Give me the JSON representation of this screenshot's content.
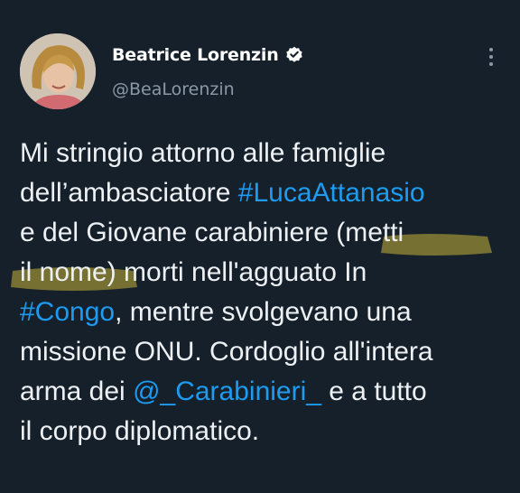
{
  "tweet": {
    "author": {
      "display_name": "Beatrice Lorenzin",
      "handle": "@BeaLorenzin",
      "verified": true
    },
    "icons": {
      "verified": "verified-badge-icon",
      "more": "more-options-icon"
    },
    "text_lines": [
      [
        {
          "t": "Mi stringio attorno alle famiglie"
        }
      ],
      [
        {
          "t": "dell’ambasciatore "
        },
        {
          "t": "#LucaAttanasio",
          "link": true
        }
      ],
      [
        {
          "t": "e del Giovane carabiniere (metti"
        }
      ],
      [
        {
          "t": "il nome) morti nell'agguato In"
        }
      ],
      [
        {
          "t": "#Congo",
          "link": true
        },
        {
          "t": ", mentre svolgevano una"
        }
      ],
      [
        {
          "t": "missione ONU. Cordoglio all'intera"
        }
      ],
      [
        {
          "t": "arma dei "
        },
        {
          "t": "@_Carabinieri_",
          "link": true
        },
        {
          "t": " e a tutto"
        }
      ],
      [
        {
          "t": "il corpo diplomatico."
        }
      ]
    ]
  },
  "colors": {
    "background": "#15202b",
    "text": "#eef1f4",
    "secondary_text": "#8b98a5",
    "link": "#1d9bf0",
    "highlight": "#c9b33a"
  }
}
